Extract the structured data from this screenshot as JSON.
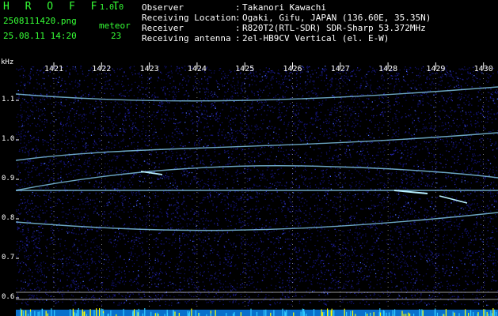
{
  "app": {
    "brand": "H R O F F T",
    "version": "1.0.0"
  },
  "file": {
    "name": "2508111420.png",
    "datetime": "25.08.11 14:20"
  },
  "meteor": {
    "label": "meteor",
    "count": "23"
  },
  "station": [
    {
      "label": "Observer",
      "value": "Takanori Kawachi"
    },
    {
      "label": "Receiving Location",
      "value": "Ogaki, Gifu, JAPAN (136.60E, 35.35N)"
    },
    {
      "label": "Receiver",
      "value": "R820T2(RTL-SDR) SDR-Sharp 53.372MHz"
    },
    {
      "label": "Receiving antenna",
      "value": "2el-HB9CV Vertical (el. E-W)"
    }
  ],
  "axis": {
    "unit": "kHz",
    "x_ticks": [
      "1421",
      "1422",
      "1423",
      "1424",
      "1425",
      "1426",
      "1427",
      "1428",
      "1429",
      "1430"
    ],
    "y_ticks": [
      "1.1",
      "1.0",
      "0.9",
      "0.8",
      "0.7",
      "0.6"
    ]
  },
  "colors": {
    "header_green": "#36ff36",
    "background": "#000000",
    "noise": "#10106a",
    "trace": "#8fdcff",
    "spike": "#ffff00"
  }
}
